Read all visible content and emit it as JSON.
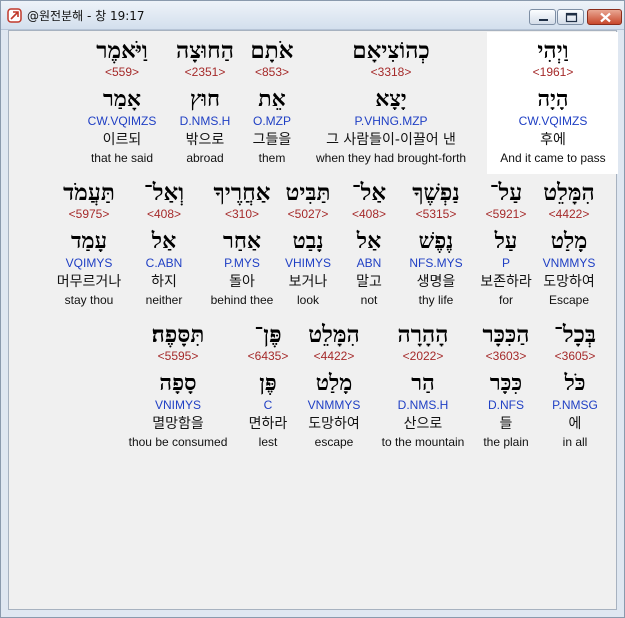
{
  "window": {
    "title": "@원전분해 - 창 19:17",
    "colors": {
      "strong": "#a52a2a",
      "parse": "#1f3fc4",
      "highlight": "#ffffff"
    }
  },
  "words": [
    {
      "hebrew": "וַיְהִי",
      "strong": "<1961>",
      "lemma": "הָיָה",
      "parse": "CW.VQIMZS",
      "korean": "후에",
      "english": "And it came to pass"
    },
    {
      "hebrew": "כְהוֹצִיאָם",
      "strong": "<3318>",
      "lemma": "יָצָא",
      "parse": "P.VHNG.MZP",
      "korean": "그 사람들이-이끌어 낸",
      "english": "when they had brought-forth"
    },
    {
      "hebrew": "אֹתָם",
      "strong": "<853>",
      "lemma": "אֵת",
      "parse": "O.MZP",
      "korean": "그들을",
      "english": "them"
    },
    {
      "hebrew": "הַחוּצָה",
      "strong": "<2351>",
      "lemma": "חוּץ",
      "parse": "D.NMS.H",
      "korean": "밖으로",
      "english": "abroad"
    },
    {
      "hebrew": "וַיֹּאמֶר",
      "strong": "<559>",
      "lemma": "אָמַר",
      "parse": "CW.VQIMZS",
      "korean": "이르되",
      "english": "that he said"
    },
    {
      "hebrew": "הִמָּלֵט",
      "strong": "<4422>",
      "lemma": "מָלַט",
      "parse": "VNMMYS",
      "korean": "도망하여",
      "english": "Escape"
    },
    {
      "hebrew": "עַל־",
      "strong": "<5921>",
      "lemma": "עַל",
      "parse": "P",
      "korean": "보존하라",
      "english": "for"
    },
    {
      "hebrew": "נַפְשֶׁךָ",
      "strong": "<5315>",
      "lemma": "נֶפֶשׁ",
      "parse": "NFS.MYS",
      "korean": "생명을",
      "english": "thy life"
    },
    {
      "hebrew": "אַל־",
      "strong": "<408>",
      "lemma": "אַל",
      "parse": "ABN",
      "korean": "말고",
      "english": "not"
    },
    {
      "hebrew": "תַּבִּיט",
      "strong": "<5027>",
      "lemma": "נָבַט",
      "parse": "VHIMYS",
      "korean": "보거나",
      "english": "look"
    },
    {
      "hebrew": "אַחֲרֶיךָ",
      "strong": "<310>",
      "lemma": "אַחַר",
      "parse": "P.MYS",
      "korean": "돌아",
      "english": "behind thee"
    },
    {
      "hebrew": "וְאַל־",
      "strong": "<408>",
      "lemma": "אַל",
      "parse": "C.ABN",
      "korean": "하지",
      "english": "neither"
    },
    {
      "hebrew": "תַּעֲמֹד",
      "strong": "<5975>",
      "lemma": "עָמַד",
      "parse": "VQIMYS",
      "korean": "머무르거나",
      "english": "stay thou"
    },
    {
      "hebrew": "בְּכָל־",
      "strong": "<3605>",
      "lemma": "כֹּל",
      "parse": "P.NMSG",
      "korean": "에",
      "english": "in all"
    },
    {
      "hebrew": "הַכִּכָּר",
      "strong": "<3603>",
      "lemma": "כִּכָּר",
      "parse": "D.NFS",
      "korean": "들",
      "english": "the plain"
    },
    {
      "hebrew": "הָהָרָה",
      "strong": "<2022>",
      "lemma": "הַר",
      "parse": "D.NMS.H",
      "korean": "산으로",
      "english": "to the mountain"
    },
    {
      "hebrew": "הִמָּלֵט",
      "strong": "<4422>",
      "lemma": "מָלַט",
      "parse": "VNMMYS",
      "korean": "도망하여",
      "english": "escape"
    },
    {
      "hebrew": "פֶּן־",
      "strong": "<6435>",
      "lemma": "פֶּן",
      "parse": "C",
      "korean": "면하라",
      "english": "lest"
    },
    {
      "hebrew": "תִּסָּפֶה׃",
      "strong": "<5595>",
      "lemma": "סָפָה",
      "parse": "VNIMYS",
      "korean": "멸망함을",
      "english": "thou be consumed"
    }
  ]
}
